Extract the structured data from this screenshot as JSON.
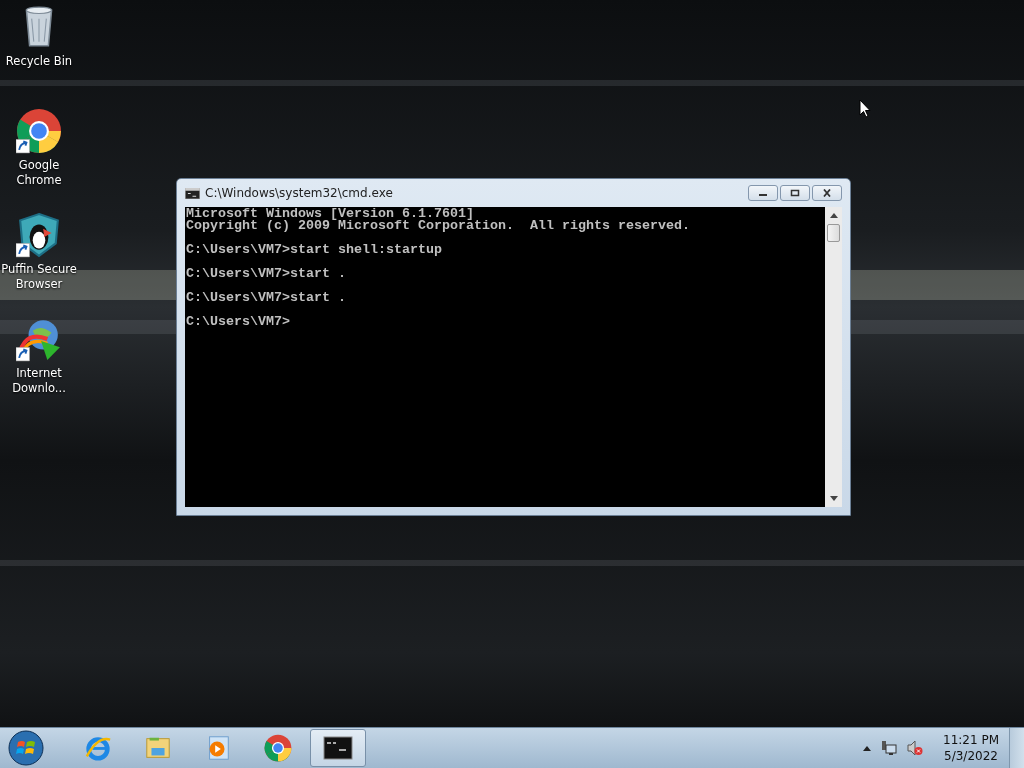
{
  "desktop_icons": [
    {
      "kind": "recycle-bin",
      "label": "Recycle Bin",
      "shortcut": false
    },
    {
      "kind": "chrome",
      "label": "Google Chrome",
      "shortcut": true
    },
    {
      "kind": "puffin",
      "label": "Puffin Secure Browser",
      "shortcut": true
    },
    {
      "kind": "idm",
      "label": "Internet Downlo...",
      "shortcut": true
    }
  ],
  "console_window": {
    "title": "C:\\Windows\\system32\\cmd.exe",
    "output_blocks": [
      [
        "Microsoft Windows [Version 6.1.7601]",
        "Copyright (c) 2009 Microsoft Corporation.  All rights reserved."
      ],
      [
        "C:\\Users\\VM7>start shell:startup"
      ],
      [
        "C:\\Users\\VM7>start ."
      ],
      [
        "C:\\Users\\VM7>start ."
      ],
      [
        "C:\\Users\\VM7>"
      ]
    ]
  },
  "taskbar": {
    "items": [
      {
        "kind": "ie",
        "selected": false
      },
      {
        "kind": "explorer",
        "selected": false
      },
      {
        "kind": "media",
        "selected": false
      },
      {
        "kind": "chrome",
        "selected": false
      },
      {
        "kind": "cmd",
        "selected": true
      }
    ],
    "tray": [
      {
        "kind": "expand"
      },
      {
        "kind": "network"
      },
      {
        "kind": "volume-muted"
      }
    ],
    "time": "11:21 PM",
    "date": "5/3/2022"
  }
}
